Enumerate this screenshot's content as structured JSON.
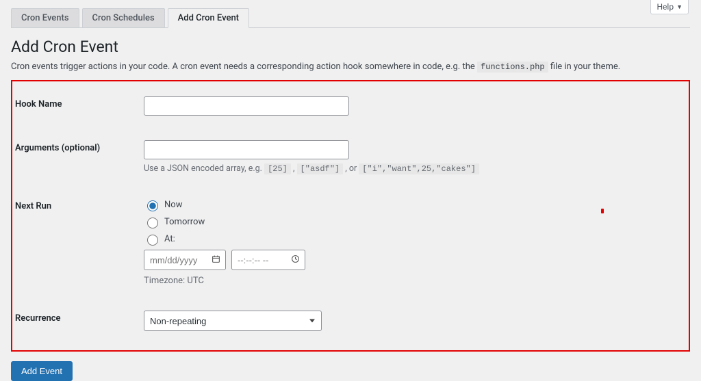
{
  "help": {
    "label": "Help"
  },
  "tabs": [
    {
      "label": "Cron Events"
    },
    {
      "label": "Cron Schedules"
    },
    {
      "label": "Add Cron Event"
    }
  ],
  "page": {
    "title": "Add Cron Event",
    "desc_prefix": "Cron events trigger actions in your code. A cron event needs a corresponding action hook somewhere in code, e.g. the ",
    "desc_code": "functions.php",
    "desc_suffix": " file in your theme."
  },
  "form": {
    "hook_name": {
      "label": "Hook Name",
      "value": ""
    },
    "arguments": {
      "label": "Arguments (optional)",
      "value": "",
      "hint_prefix": "Use a JSON encoded array, e.g. ",
      "hint_code1": "[25]",
      "hint_sep1": " , ",
      "hint_code2": "[\"asdf\"]",
      "hint_sep2": " , or ",
      "hint_code3": "[\"i\",\"want\",25,\"cakes\"]"
    },
    "next_run": {
      "label": "Next Run",
      "now": "Now",
      "tomorrow": "Tomorrow",
      "at": "At:",
      "date_placeholder": "mm/dd/yyyy",
      "time_placeholder": "--:--:-- --",
      "timezone": "Timezone: UTC"
    },
    "recurrence": {
      "label": "Recurrence",
      "value": "Non-repeating"
    }
  },
  "actions": {
    "add_event": "Add Event"
  }
}
